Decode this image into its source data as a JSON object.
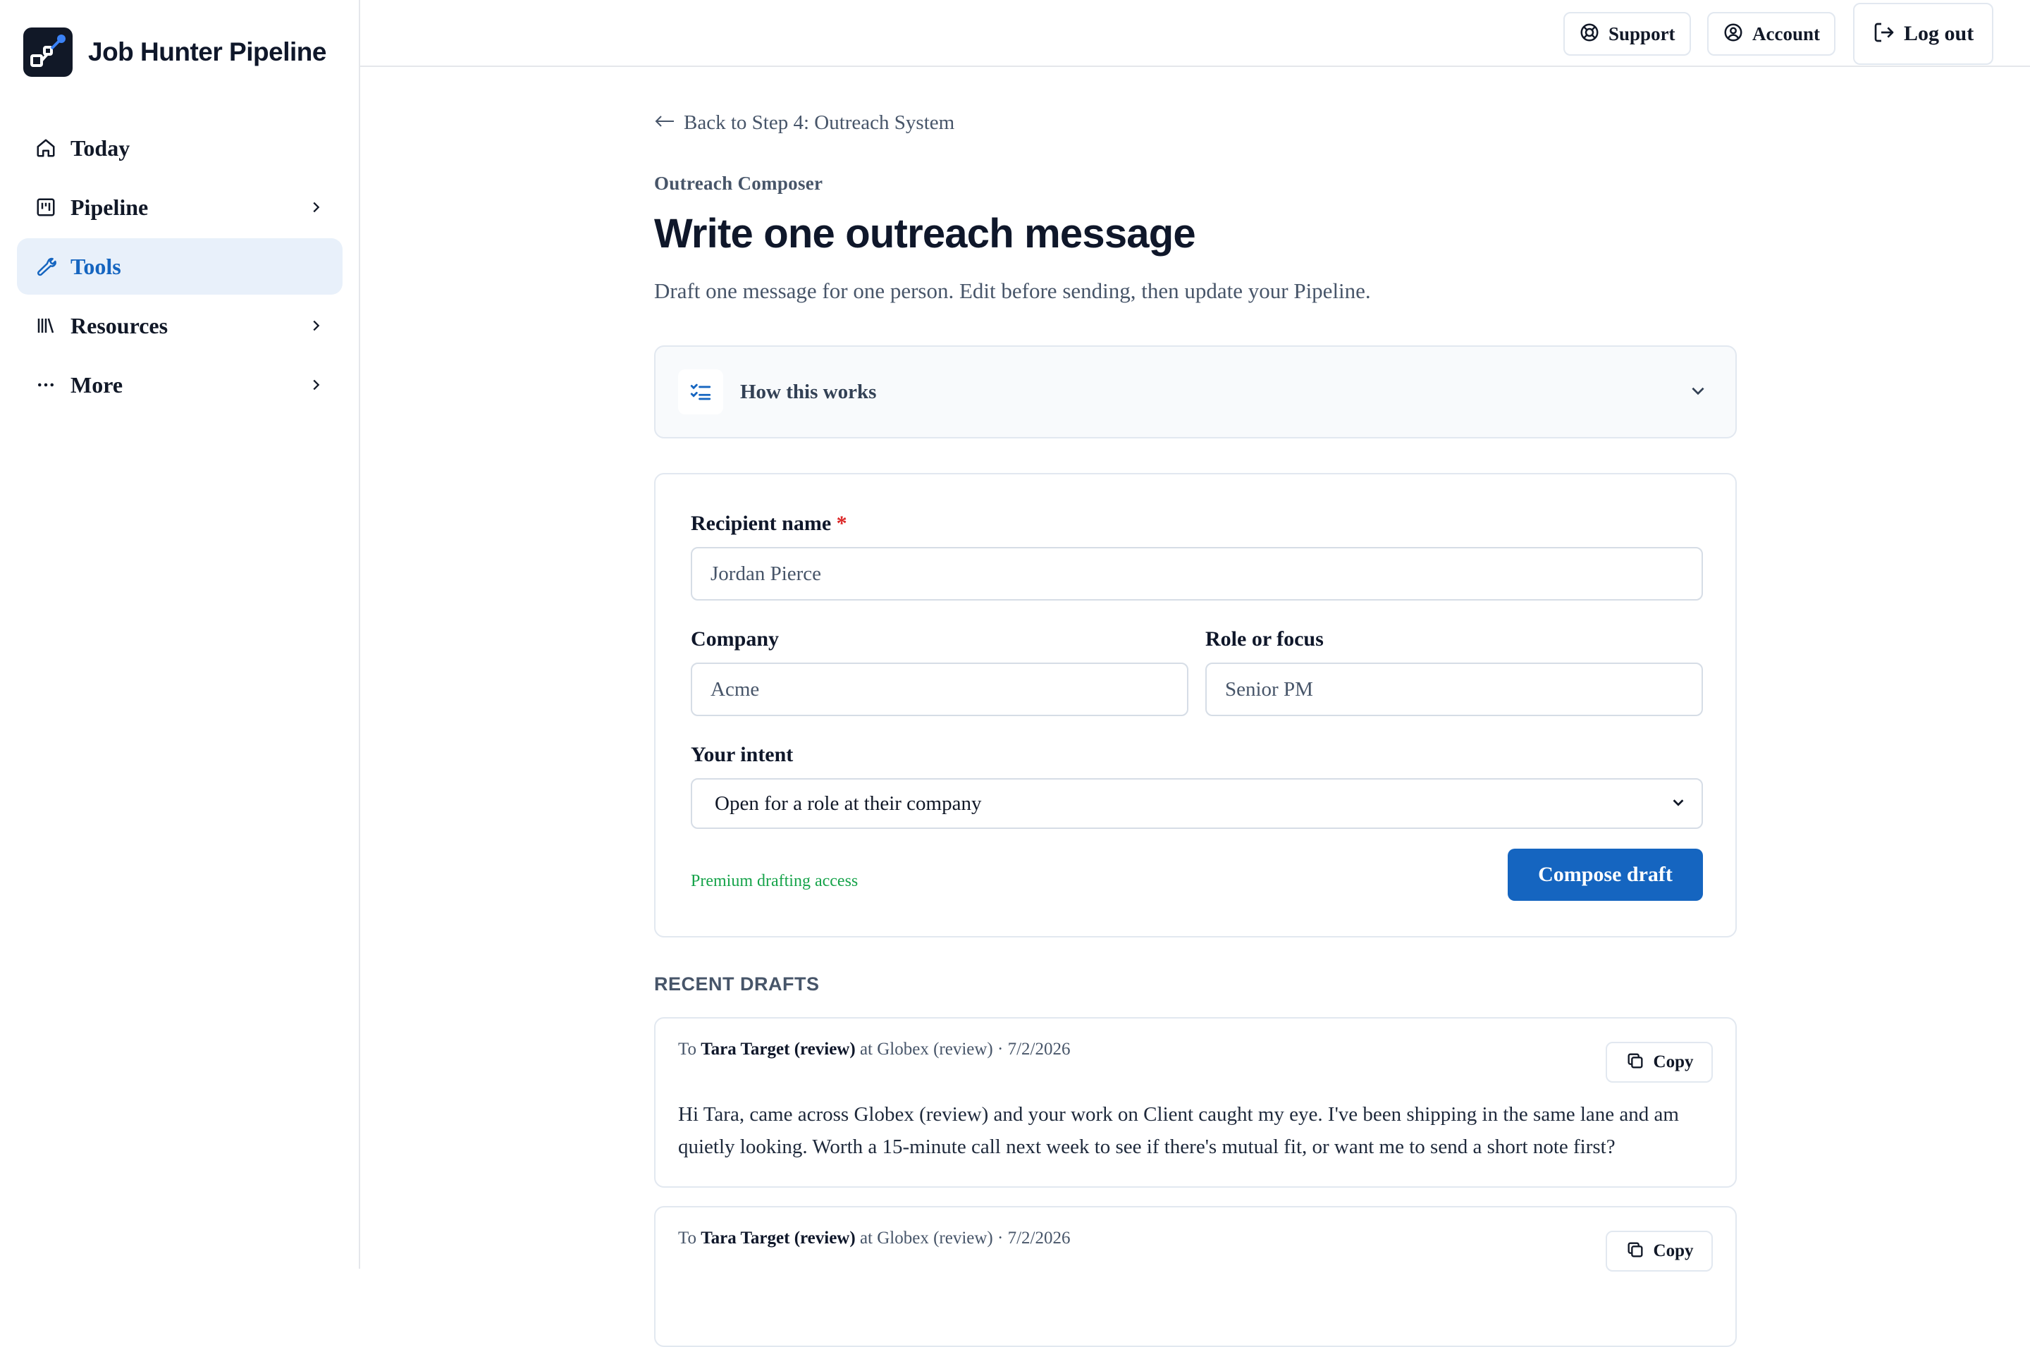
{
  "app": {
    "title": "Job Hunter Pipeline"
  },
  "sidebar": {
    "items": [
      {
        "label": "Today",
        "icon": "home-icon",
        "active": false,
        "has_chevron": false
      },
      {
        "label": "Pipeline",
        "icon": "kanban-icon",
        "active": false,
        "has_chevron": true
      },
      {
        "label": "Tools",
        "icon": "wrench-icon",
        "active": true,
        "has_chevron": false
      },
      {
        "label": "Resources",
        "icon": "library-icon",
        "active": false,
        "has_chevron": true
      },
      {
        "label": "More",
        "icon": "ellipsis-icon",
        "active": false,
        "has_chevron": true
      }
    ]
  },
  "topbar": {
    "support_label": "Support",
    "account_label": "Account",
    "logout_label": "Log out"
  },
  "page": {
    "back_link": "Back to Step 4: Outreach System",
    "eyebrow": "Outreach Composer",
    "title": "Write one outreach message",
    "subtitle": "Draft one message for one person. Edit before sending, then update your Pipeline."
  },
  "how_it_works": {
    "label": "How this works",
    "expanded": false
  },
  "form": {
    "recipient_label": "Recipient name",
    "required_mark": "*",
    "recipient_value": "Jordan Pierce",
    "company_label": "Company",
    "company_value": "Acme",
    "role_label": "Role or focus",
    "role_value": "Senior PM",
    "intent_label": "Your intent",
    "intent_value": "Open for a role at their company",
    "premium_note": "Premium drafting access",
    "compose_label": "Compose draft"
  },
  "recent_drafts": {
    "heading": "RECENT DRAFTS",
    "items": [
      {
        "to_prefix": "To",
        "recipient": "Tara Target (review)",
        "at_text": "at Globex (review) · 7/2/2026",
        "copy_label": "Copy",
        "body": "Hi Tara, came across Globex (review) and your work on Client caught my eye. I've been shipping in the same lane and am quietly looking. Worth a 15-minute call next week to see if there's mutual fit, or want me to send a short note first?"
      },
      {
        "to_prefix": "To",
        "recipient": "Tara Target (review)",
        "at_text": "at Globex (review) · 7/2/2026",
        "copy_label": "Copy",
        "body": ""
      }
    ]
  },
  "colors": {
    "accent": "#1565c0",
    "active_bg": "#e8f0fa",
    "premium": "#16a34a",
    "required": "#dc2626"
  }
}
